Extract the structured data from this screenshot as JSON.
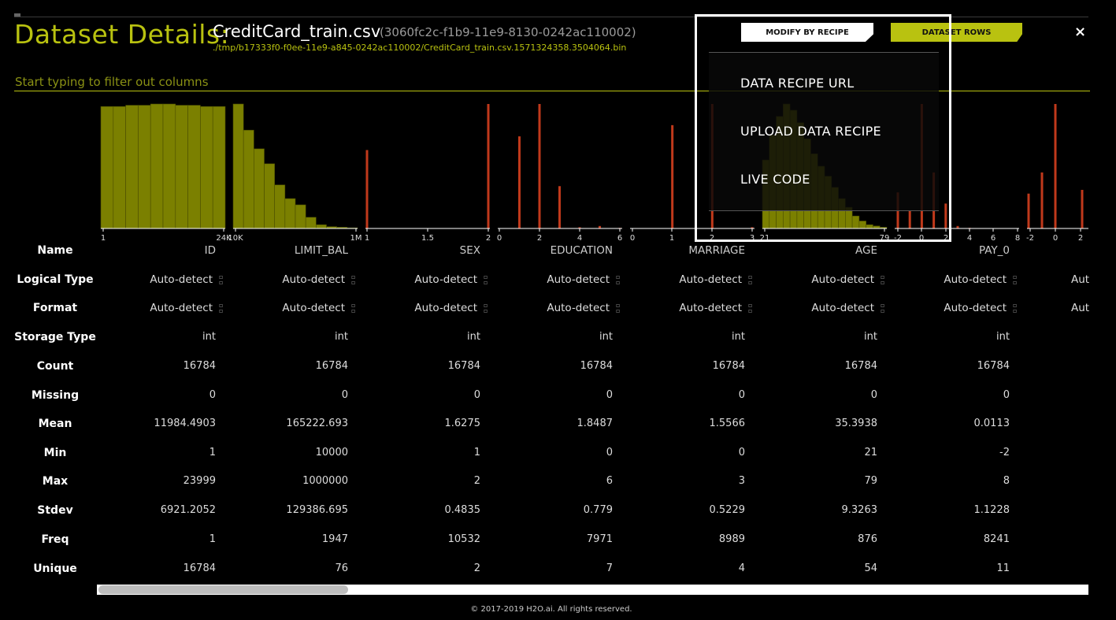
{
  "header": {
    "title": "Dataset Details:",
    "file_name": "CreditCard_train.csv",
    "dataset_id": "(3060fc2c-f1b9-11e9-8130-0242ac110002)",
    "file_path": "./tmp/b17333f0-f0ee-11e9-a845-0242ac110002/CreditCard_train.csv.1571324358.3504064.bin",
    "close_label": "×"
  },
  "toolbar": {
    "modify_label": "MODIFY BY RECIPE",
    "rows_label": "DATASET ROWS"
  },
  "filter": {
    "placeholder": "Start typing to filter out columns"
  },
  "recipe_menu": {
    "items": [
      "DATA RECIPE URL",
      "UPLOAD DATA RECIPE",
      "LIVE CODE"
    ]
  },
  "row_labels": {
    "name": "Name",
    "logical_type": "Logical Type",
    "format": "Format",
    "storage_type": "Storage Type",
    "count": "Count",
    "missing": "Missing",
    "mean": "Mean",
    "min": "Min",
    "max": "Max",
    "stdev": "Stdev",
    "freq": "Freq",
    "unique": "Unique"
  },
  "columns": [
    {
      "name": "ID",
      "logical_type": "Auto-detect",
      "format": "Auto-detect",
      "storage_type": "int",
      "count": "16784",
      "missing": "0",
      "mean": "11984.4903",
      "min": "1",
      "max": "23999",
      "stdev": "6921.2052",
      "freq": "1",
      "unique": "16784",
      "axis": [
        "1",
        "24K"
      ]
    },
    {
      "name": "LIMIT_BAL",
      "logical_type": "Auto-detect",
      "format": "Auto-detect",
      "storage_type": "int",
      "count": "16784",
      "missing": "0",
      "mean": "165222.693",
      "min": "10000",
      "max": "1000000",
      "stdev": "129386.695",
      "freq": "1947",
      "unique": "76",
      "axis": [
        "10K",
        "1M"
      ]
    },
    {
      "name": "SEX",
      "logical_type": "Auto-detect",
      "format": "Auto-detect",
      "storage_type": "int",
      "count": "16784",
      "missing": "0",
      "mean": "1.6275",
      "min": "1",
      "max": "2",
      "stdev": "0.4835",
      "freq": "10532",
      "unique": "2",
      "axis": [
        "1",
        "1.5",
        "2"
      ]
    },
    {
      "name": "EDUCATION",
      "logical_type": "Auto-detect",
      "format": "Auto-detect",
      "storage_type": "int",
      "count": "16784",
      "missing": "0",
      "mean": "1.8487",
      "min": "0",
      "max": "6",
      "stdev": "0.779",
      "freq": "7971",
      "unique": "7",
      "axis": [
        "0",
        "2",
        "4",
        "6"
      ]
    },
    {
      "name": "MARRIAGE",
      "logical_type": "Auto-detect",
      "format": "Auto-detect",
      "storage_type": "int",
      "count": "16784",
      "missing": "0",
      "mean": "1.5566",
      "min": "0",
      "max": "3",
      "stdev": "0.5229",
      "freq": "8989",
      "unique": "4",
      "axis": [
        "0",
        "1",
        "2",
        "3"
      ]
    },
    {
      "name": "AGE",
      "logical_type": "Auto-detect",
      "format": "Auto-detect",
      "storage_type": "int",
      "count": "16784",
      "missing": "0",
      "mean": "35.3938",
      "min": "21",
      "max": "79",
      "stdev": "9.3263",
      "freq": "876",
      "unique": "54",
      "axis": [
        "21",
        "79"
      ]
    },
    {
      "name": "PAY_0",
      "logical_type": "Auto-detect",
      "format": "Auto-detect",
      "storage_type": "int",
      "count": "16784",
      "missing": "0",
      "mean": "0.0113",
      "min": "-2",
      "max": "8",
      "stdev": "1.1228",
      "freq": "8241",
      "unique": "11",
      "axis": [
        "-2",
        "0",
        "2",
        "4",
        "6",
        "8"
      ]
    }
  ],
  "next_column": {
    "logical_type": "Aut",
    "format": "Aut",
    "axis": [
      "-2",
      "0",
      "2"
    ]
  },
  "histograms": {
    "colors": {
      "continuous": "#7b8000",
      "discrete": "#c0391b",
      "axis": "#ffffff"
    },
    "ID": [
      0.98,
      0.98,
      0.99,
      0.99,
      1.0,
      1.0,
      0.99,
      0.99,
      0.98,
      0.98
    ],
    "LIMIT_BAL": [
      1.0,
      0.79,
      0.64,
      0.52,
      0.35,
      0.24,
      0.19,
      0.09,
      0.03,
      0.015,
      0.01,
      0.005
    ],
    "SEX": {
      "1": 0.63,
      "2": 1.0
    },
    "EDUCATION": {
      "0": 0.0,
      "1": 0.74,
      "2": 1.0,
      "3": 0.34,
      "4": 0.01,
      "5": 0.02,
      "6": 0.005
    },
    "MARRIAGE": {
      "0": 0.0,
      "1": 0.83,
      "2": 1.0,
      "3": 0.01
    },
    "AGE": [
      0.55,
      0.75,
      0.9,
      1.0,
      0.95,
      0.85,
      0.72,
      0.6,
      0.5,
      0.42,
      0.33,
      0.24,
      0.17,
      0.1,
      0.06,
      0.03,
      0.02,
      0.01
    ],
    "PAY_0": {
      "-2": 0.29,
      "-1": 0.14,
      "0": 1.0,
      "1": 0.45,
      "2": 0.2,
      "3": 0.02,
      "4": 0.005,
      "5": 0.003,
      "6": 0.002,
      "7": 0.002,
      "8": 0.003
    },
    "NEXT": {
      "-2": 0.28,
      "-1": 0.45,
      "0": 1.0,
      "1": 0.0,
      "2": 0.31
    }
  },
  "footer": "© 2017-2019 H2O.ai. All rights reserved."
}
